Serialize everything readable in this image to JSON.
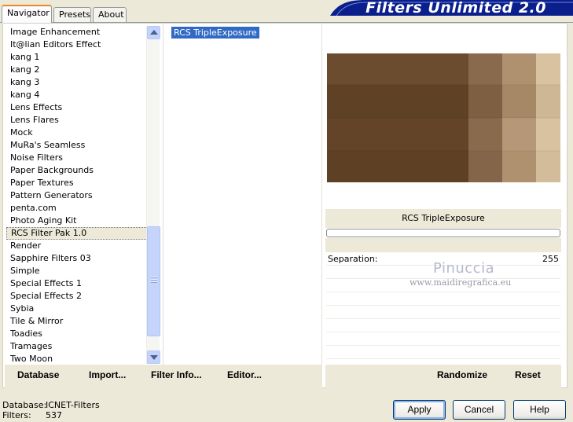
{
  "tabs": [
    {
      "label": "Navigator",
      "active": true
    },
    {
      "label": "Presets",
      "active": false
    },
    {
      "label": "About",
      "active": false
    }
  ],
  "logo_text": "Filters Unlimited 2.0",
  "categories": [
    "Image Enhancement",
    "It@lian Editors Effect",
    "kang 1",
    "kang 2",
    "kang 3",
    "kang 4",
    "Lens Effects",
    "Lens Flares",
    "Mock",
    "MuRa's Seamless",
    "Noise Filters",
    "Paper Backgrounds",
    "Paper Textures",
    "Pattern Generators",
    "penta.com",
    "Photo Aging Kit",
    "RCS Filter Pak 1.0",
    "Render",
    "Sapphire Filters 03",
    "Simple",
    "Special Effects 1",
    "Special Effects 2",
    "Sybia",
    "Tile & Mirror",
    "Toadies",
    "Tramages",
    "Two Moon"
  ],
  "selected_category": "RCS Filter Pak 1.0",
  "filters": [
    "RCS TripleExposure"
  ],
  "selected_filter": "RCS TripleExposure",
  "filter_title": "RCS TripleExposure",
  "parameters": [
    {
      "label": "Separation:",
      "value": "255"
    }
  ],
  "watermark": {
    "line1": "Pinuccia",
    "line2": "www.maidiregrafica.eu"
  },
  "actions": {
    "database": "Database",
    "import": "Import...",
    "filter_info": "Filter Info...",
    "editor": "Editor...",
    "randomize": "Randomize",
    "reset": "Reset"
  },
  "status": {
    "database_label": "Database:",
    "database_value": "ICNET-Filters",
    "filters_label": "Filters:",
    "filters_value": "537"
  },
  "buttons": {
    "apply": "Apply",
    "cancel": "Cancel",
    "help": "Help"
  },
  "colors": {
    "selection": "#316ac5",
    "logo_blue": "#0a1e8c",
    "preview_dark": "#5e4025",
    "preview_light": "#d8c2a0"
  }
}
